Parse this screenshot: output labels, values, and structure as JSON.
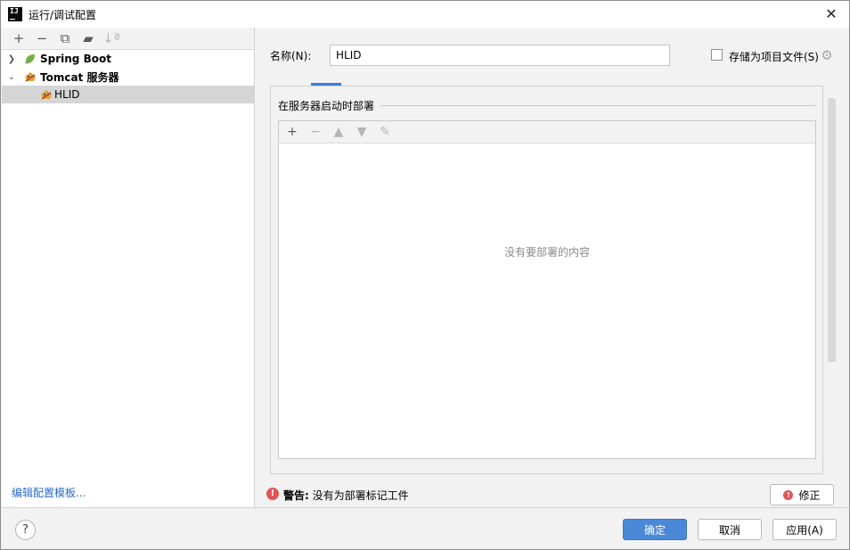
{
  "window": {
    "title": "运行/调试配置",
    "app_icon_text": "IJ"
  },
  "left_toolbar": {
    "add": "+",
    "remove": "−",
    "copy": "⧉",
    "folder": "▰",
    "sort": "↓ª"
  },
  "tree": {
    "spring_boot": "Spring Boot",
    "tomcat": "Tomcat 服务器",
    "hlid": "HLID"
  },
  "edit_templates_link": "编辑配置模板...",
  "form": {
    "name_label": "名称(N):",
    "name_value": "HLID",
    "store_label": "存储为项目文件(S)"
  },
  "deploy": {
    "section_title": "在服务器启动时部署",
    "add": "+",
    "remove": "−",
    "up": "▲",
    "down": "▼",
    "edit": "✎",
    "empty_text": "没有要部署的内容"
  },
  "warning": {
    "prefix": "警告:",
    "text": " 没有为部署标记工件",
    "fix_label": "修正"
  },
  "buttons": {
    "help": "?",
    "ok": "确定",
    "cancel": "取消",
    "apply": "应用(A)"
  },
  "colors": {
    "accent": "#4a89d8",
    "error": "#e05555",
    "link": "#2a6ac8"
  }
}
